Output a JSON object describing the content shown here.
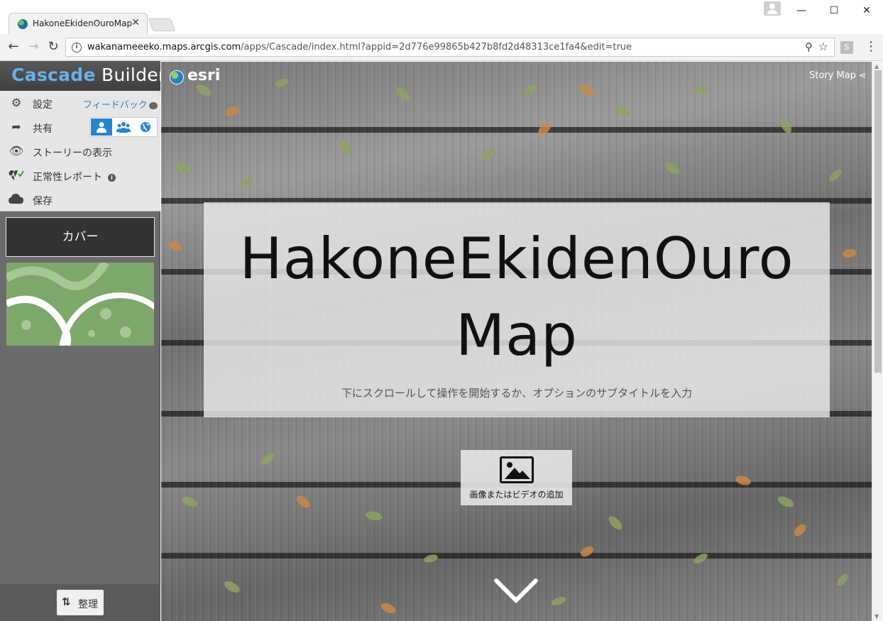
{
  "browser": {
    "tab_title": "HakoneEkidenOuroMap",
    "tab_close": "✕",
    "url_host": "wakanameeeko.maps.arcgis.com",
    "url_path": "/apps/Cascade/index.html?appid=2d776e99865b427b8fd2d48313ce1fa4&edit=true",
    "minimize": "—",
    "maximize": "☐",
    "close": "✕",
    "back": "←",
    "forward": "→",
    "reload": "↻",
    "extension_label": "S"
  },
  "builder": {
    "brand_part1": "Cascade",
    "brand_part2": "Builder",
    "menu": {
      "settings": "設定",
      "feedback": "フィードバック",
      "share": "共有",
      "view_story": "ストーリーの表示",
      "health_report": "正常性レポート",
      "save": "保存"
    },
    "share_options": [
      "private",
      "organization",
      "public"
    ],
    "share_selected": "private",
    "sections": {
      "cover_label": "カバー"
    },
    "organize_label": "整理"
  },
  "story": {
    "esri_label": "esri",
    "storymap_label": "Story Map",
    "title": "HakoneEkidenOuro Map",
    "subtitle": "下にスクロールして操作を開始するか、オプションのサブタイトルを入力",
    "add_media_label": "画像またはビデオの追加"
  },
  "colors": {
    "accent_blue": "#2585cf",
    "brand_blue": "#6ab0e6",
    "sidebar_dark": "#6b6b6b",
    "menu_bg": "#e6e6e6",
    "thumb_green": "#7ea86a"
  }
}
